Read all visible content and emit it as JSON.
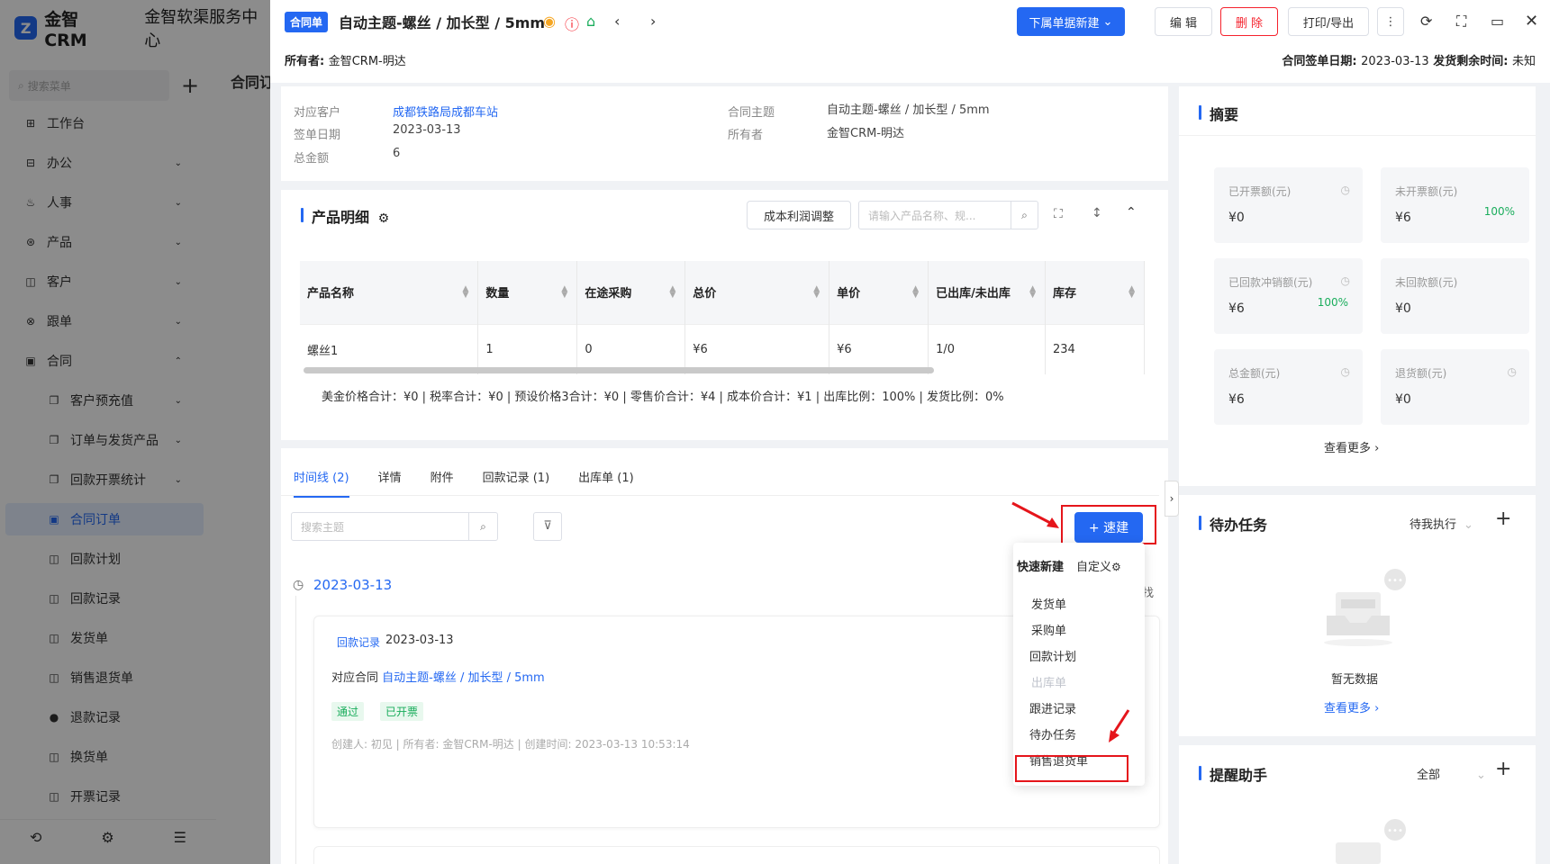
{
  "app": {
    "brand": "金智CRM",
    "company": "金智软渠服务中心",
    "search_placeholder": "搜索菜单",
    "bg_tab": "合同订"
  },
  "sidebar": {
    "items": [
      {
        "label": "工作台",
        "icon": "⊞",
        "arrow": ""
      },
      {
        "label": "办公",
        "icon": "⊟",
        "arrow": "⌄"
      },
      {
        "label": "人事",
        "icon": "♨",
        "arrow": "⌄"
      },
      {
        "label": "产品",
        "icon": "⊛",
        "arrow": "⌄"
      },
      {
        "label": "客户",
        "icon": "◫",
        "arrow": "⌄"
      },
      {
        "label": "跟单",
        "icon": "⊗",
        "arrow": "⌄"
      },
      {
        "label": "合同",
        "icon": "▣",
        "arrow": "⌃"
      },
      {
        "label": "客户预充值",
        "icon": "❐",
        "arrow": "⌄"
      },
      {
        "label": "订单与发货产品",
        "icon": "❐",
        "arrow": "⌄"
      },
      {
        "label": "回款开票统计",
        "icon": "❐",
        "arrow": "⌄"
      },
      {
        "label": "合同订单",
        "icon": "▣",
        "arrow": ""
      },
      {
        "label": "回款计划",
        "icon": "◫",
        "arrow": ""
      },
      {
        "label": "回款记录",
        "icon": "◫",
        "arrow": ""
      },
      {
        "label": "发货单",
        "icon": "◫",
        "arrow": ""
      },
      {
        "label": "销售退货单",
        "icon": "◫",
        "arrow": ""
      },
      {
        "label": "退款记录",
        "icon": "●",
        "arrow": ""
      },
      {
        "label": "换货单",
        "icon": "◫",
        "arrow": ""
      },
      {
        "label": "开票记录",
        "icon": "◫",
        "arrow": ""
      }
    ]
  },
  "header": {
    "tag": "合同单",
    "title": "自动主题-螺丝 / 加长型 / 5mm",
    "btn_new_sub": "下属单据新建",
    "btn_edit": "编 辑",
    "btn_delete": "删 除",
    "btn_print": "打印/导出",
    "owner_label": "所有者: ",
    "owner_value": "金智CRM-明达",
    "sign_date_label": "合同签单日期: ",
    "sign_date_value": "2023-03-13",
    "ship_label": "  发货剩余时间: ",
    "ship_value": "未知"
  },
  "info": {
    "customer_label": "对应客户",
    "customer_value": "成都铁路局成都车站",
    "sign_label": "签单日期",
    "sign_value": "2023-03-13",
    "total_label": "总金额",
    "total_value": "6",
    "subject_label": "合同主题",
    "subject_value": "自动主题-螺丝 / 加长型 / 5mm",
    "owner_label": "所有者",
    "owner_value": "金智CRM-明达"
  },
  "products": {
    "title": "产品明细",
    "btn_cost": "成本利润调整",
    "search_placeholder": "请输入产品名称、规...",
    "columns": [
      "产品名称",
      "数量",
      "在途采购",
      "总价",
      "单价",
      "已出库/未出库",
      "库存"
    ],
    "rows": [
      [
        "螺丝1",
        "1",
        "0",
        "¥6",
        "¥6",
        "1/0",
        "234"
      ]
    ],
    "summary": "美金价格合计：¥0 |   税率合计：¥0 |   预设价格3合计：¥0 |   零售价合计：¥4 |   成本价合计：¥1 |   出库比例：100% |   发货比例：0%"
  },
  "tabs": [
    "时间线 (2)",
    "详情",
    "附件",
    "回款记录 (1)",
    "出库单 (1)"
  ],
  "timeline": {
    "search_placeholder": "搜索主题",
    "btn_quick": "+ 速建",
    "date": "2023-03-13",
    "card_type": "回款记录",
    "card_date": "2023-03-13",
    "contract_label": "对应合同 ",
    "contract_value": "自动主题-螺丝 / 加长型 / 5mm",
    "badge1": "通过",
    "badge2": "已开票",
    "meta": "创建人: 初见   |   所有者: 金智CRM-明达   |   创建时间: 2023-03-13 10:53:14",
    "right_cut": "找"
  },
  "quick_menu": {
    "title": "快速新建",
    "custom": "自定义",
    "items": [
      "发货单",
      "采购单",
      "回款计划",
      "出库单",
      "跟进记录",
      "待办任务",
      "销售退货单"
    ]
  },
  "summary": {
    "title": "摘要",
    "cards": [
      {
        "k": "已开票额(元)",
        "v": "¥0",
        "p": ""
      },
      {
        "k": "未开票额(元)",
        "v": "¥6",
        "p": "100%"
      },
      {
        "k": "已回款冲销额(元)",
        "v": "¥6",
        "p": "100%"
      },
      {
        "k": "未回款额(元)",
        "v": "¥0",
        "p": ""
      },
      {
        "k": "总金额(元)",
        "v": "¥6",
        "p": ""
      },
      {
        "k": "退货额(元)",
        "v": "¥0",
        "p": ""
      }
    ],
    "more": "查看更多"
  },
  "todo": {
    "title": "待办任务",
    "filter": "待我执行",
    "empty": "暂无数据",
    "more": "查看更多"
  },
  "reminder": {
    "title": "提醒助手",
    "filter": "全部"
  },
  "colors": {
    "accent": "#2468f2",
    "danger": "#e5151b",
    "success": "#1aad5c"
  }
}
